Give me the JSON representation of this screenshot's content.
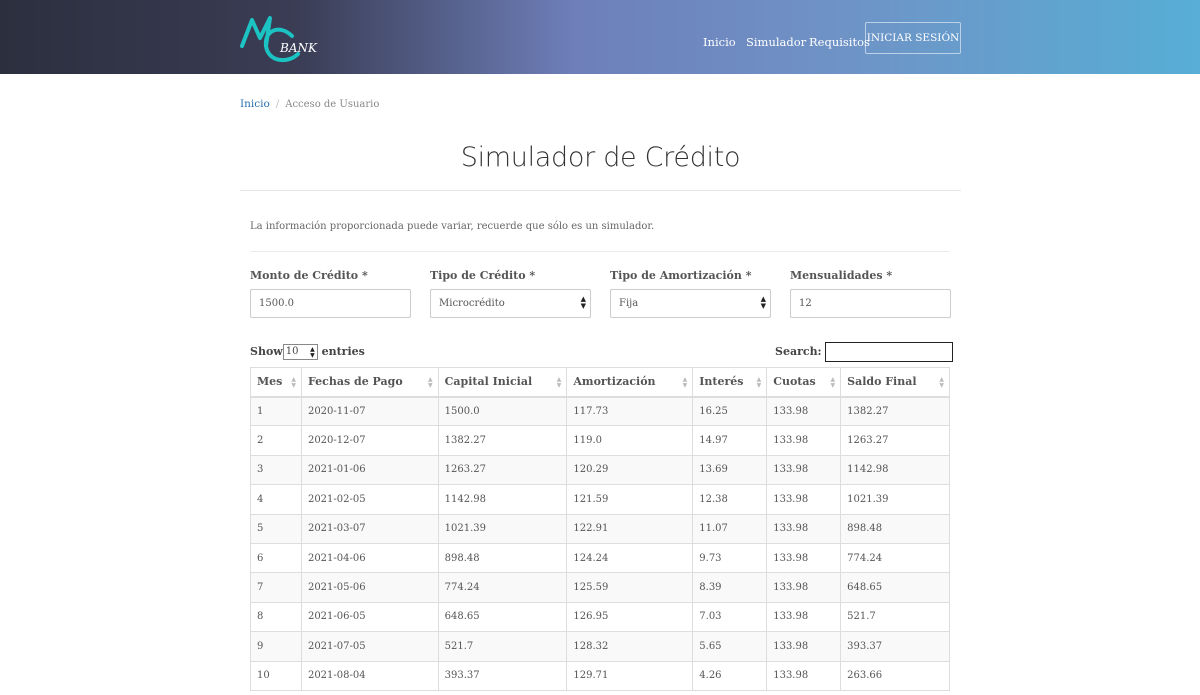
{
  "brand": {
    "logo_text": "BANK"
  },
  "nav": {
    "items": [
      "Inicio",
      "Simulador",
      "Requisitos"
    ],
    "login": "INICIAR SESIÓN"
  },
  "breadcrumb": {
    "home": "Inicio",
    "separator": "/",
    "current": "Acceso de Usuario"
  },
  "page_title": "Simulador de Crédito",
  "info_text": "La información proporcionada puede variar, recuerde que sólo es un simulador.",
  "form": {
    "monto": {
      "label": "Monto de Crédito *",
      "value": "1500.0"
    },
    "tipo_credito": {
      "label": "Tipo de Crédito *",
      "value": "Microcrédito"
    },
    "tipo_amortizacion": {
      "label": "Tipo de Amortización *",
      "value": "Fija"
    },
    "mensualidades": {
      "label": "Mensualidades *",
      "value": "12"
    }
  },
  "table_controls": {
    "show_label": "Show",
    "entries_value": "10",
    "entries_label": "entries",
    "search_label": "Search:"
  },
  "table": {
    "headers": [
      "Mes",
      "Fechas de Pago",
      "Capital Inicial",
      "Amortización",
      "Interés",
      "Cuotas",
      "Saldo Final"
    ],
    "rows": [
      [
        "1",
        "2020-11-07",
        "1500.0",
        "117.73",
        "16.25",
        "133.98",
        "1382.27"
      ],
      [
        "2",
        "2020-12-07",
        "1382.27",
        "119.0",
        "14.97",
        "133.98",
        "1263.27"
      ],
      [
        "3",
        "2021-01-06",
        "1263.27",
        "120.29",
        "13.69",
        "133.98",
        "1142.98"
      ],
      [
        "4",
        "2021-02-05",
        "1142.98",
        "121.59",
        "12.38",
        "133.98",
        "1021.39"
      ],
      [
        "5",
        "2021-03-07",
        "1021.39",
        "122.91",
        "11.07",
        "133.98",
        "898.48"
      ],
      [
        "6",
        "2021-04-06",
        "898.48",
        "124.24",
        "9.73",
        "133.98",
        "774.24"
      ],
      [
        "7",
        "2021-05-06",
        "774.24",
        "125.59",
        "8.39",
        "133.98",
        "648.65"
      ],
      [
        "8",
        "2021-06-05",
        "648.65",
        "126.95",
        "7.03",
        "133.98",
        "521.7"
      ],
      [
        "9",
        "2021-07-05",
        "521.7",
        "128.32",
        "5.65",
        "133.98",
        "393.37"
      ],
      [
        "10",
        "2021-08-04",
        "393.37",
        "129.71",
        "4.26",
        "133.98",
        "263.66"
      ]
    ]
  },
  "colors": {
    "link": "#2a6fb0",
    "logo": "#1bc3c3",
    "header_start": "#2c2f3e",
    "header_end": "#57aed6"
  }
}
